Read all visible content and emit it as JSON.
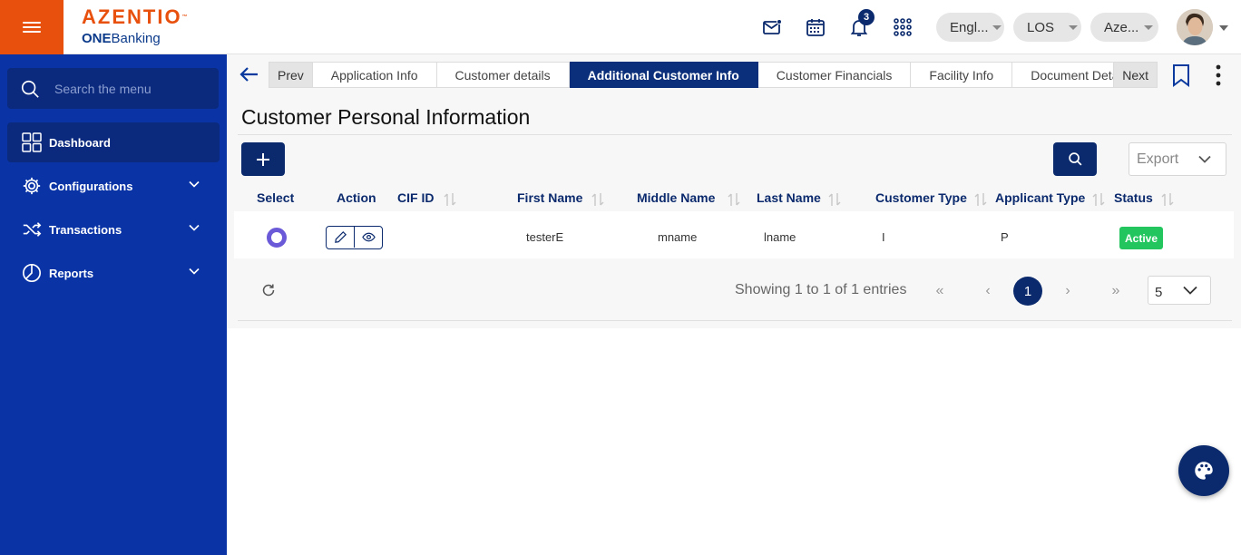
{
  "brand": {
    "logo_text": "AZENTIO",
    "trademark": "™",
    "product_bold": "ONE",
    "product_rest": "Banking"
  },
  "header": {
    "notification_count": "3",
    "language": "Engl...",
    "module": "LOS",
    "entity": "Aze...",
    "icons": [
      "menu-icon",
      "mail-icon",
      "calendar-icon",
      "bell-icon",
      "apps-grid-icon",
      "avatar",
      "chevron-down-icon"
    ]
  },
  "sidebar": {
    "search_placeholder": "Search the menu",
    "items": [
      {
        "label": "Dashboard",
        "icon": "dashboard-grid-icon",
        "active": true,
        "expandable": false
      },
      {
        "label": "Configurations",
        "icon": "gear-icon",
        "active": false,
        "expandable": true
      },
      {
        "label": "Transactions",
        "icon": "shuffle-icon",
        "active": false,
        "expandable": true
      },
      {
        "label": "Reports",
        "icon": "pie-chart-icon",
        "active": false,
        "expandable": true
      }
    ]
  },
  "tabs": {
    "prev": "Prev",
    "next": "Next",
    "items": [
      {
        "label": "Application Info",
        "active": false
      },
      {
        "label": "Customer details",
        "active": false
      },
      {
        "label": "Additional Customer Info",
        "active": true
      },
      {
        "label": "Customer Financials",
        "active": false
      },
      {
        "label": "Facility Info",
        "active": false
      },
      {
        "label": "Document Details",
        "active": false
      }
    ]
  },
  "page": {
    "title": "Customer Personal Information",
    "export_label": "Export"
  },
  "table": {
    "columns": [
      "Select",
      "Action",
      "CIF ID",
      "First Name",
      "Middle Name",
      "Last Name",
      "Customer Type",
      "Applicant Type",
      "Status"
    ],
    "rows": [
      {
        "cif_id": "",
        "first_name": "testerE",
        "middle_name": "mname",
        "last_name": "lname",
        "customer_type": "I",
        "applicant_type": "P",
        "status": "Active"
      }
    ]
  },
  "pagination": {
    "showing_text": "Showing 1 to 1 of 1 entries",
    "first": "«",
    "prev": "‹",
    "current_page": "1",
    "next": "›",
    "last": "»",
    "page_size": "5"
  },
  "colors": {
    "brand_orange": "#e8500e",
    "sidebar_blue": "#0a34a6",
    "navy": "#0b2a6d",
    "status_green": "#22c55e",
    "radio_purple": "#6a5ad8"
  }
}
